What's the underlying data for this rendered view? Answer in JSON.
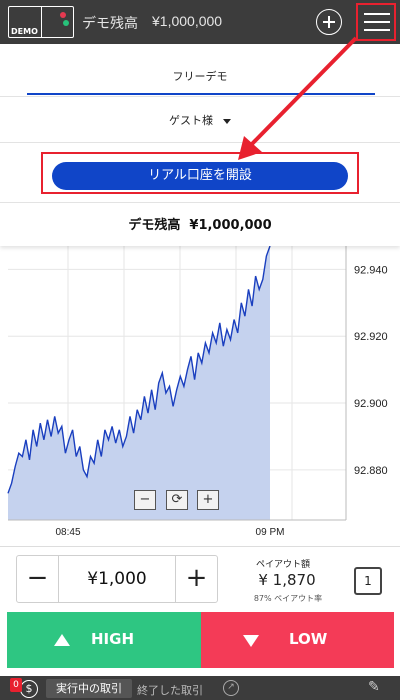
{
  "header": {
    "logo_text": "DEMO",
    "balance_label": "デモ残高",
    "balance_value": "¥1,000,000"
  },
  "menu": {
    "tab_label": "フリーデモ",
    "user_label": "ゲスト様",
    "cta_label": "リアル口座を開設",
    "balance_label": "デモ残高",
    "balance_value": "¥1,000,000"
  },
  "chart_data": {
    "type": "area",
    "y_ticks": [
      "92.940",
      "92.920",
      "92.900",
      "92.880"
    ],
    "x_ticks": [
      "08:45",
      "09 PM"
    ],
    "ylim": [
      92.865,
      92.947
    ],
    "y": [
      92.873,
      92.876,
      92.881,
      92.885,
      92.884,
      92.889,
      92.883,
      92.892,
      92.887,
      92.894,
      92.889,
      92.895,
      92.89,
      92.896,
      92.891,
      92.893,
      92.885,
      92.889,
      92.892,
      92.884,
      92.887,
      92.88,
      92.878,
      92.884,
      92.882,
      92.889,
      92.884,
      92.892,
      92.889,
      92.893,
      92.888,
      92.892,
      92.887,
      92.89,
      92.896,
      92.891,
      92.898,
      92.895,
      92.902,
      92.897,
      92.904,
      92.898,
      92.906,
      92.909,
      92.903,
      92.905,
      92.899,
      92.904,
      92.908,
      92.905,
      92.91,
      92.914,
      92.907,
      92.915,
      92.912,
      92.918,
      92.915,
      92.921,
      92.918,
      92.924,
      92.917,
      92.922,
      92.919,
      92.925,
      92.921,
      92.93,
      92.926,
      92.934,
      92.929,
      92.938,
      92.934,
      92.937,
      92.944,
      92.95
    ]
  },
  "chart_controls": {
    "minus": "−",
    "refresh": "⟳",
    "plus": "+"
  },
  "trade": {
    "minus": "−",
    "amount": "¥1,000",
    "plus": "+",
    "payout_label": "ペイアウト額",
    "payout_value": "¥ 1,870",
    "payout_rate": "87% ペイアウト率",
    "expiry": "1"
  },
  "buttons": {
    "high": "HIGH",
    "low": "LOW"
  },
  "bottom": {
    "badge": "0",
    "dollar": "$",
    "active_tab": "実行中の取引",
    "done_tab": "終了した取引"
  }
}
